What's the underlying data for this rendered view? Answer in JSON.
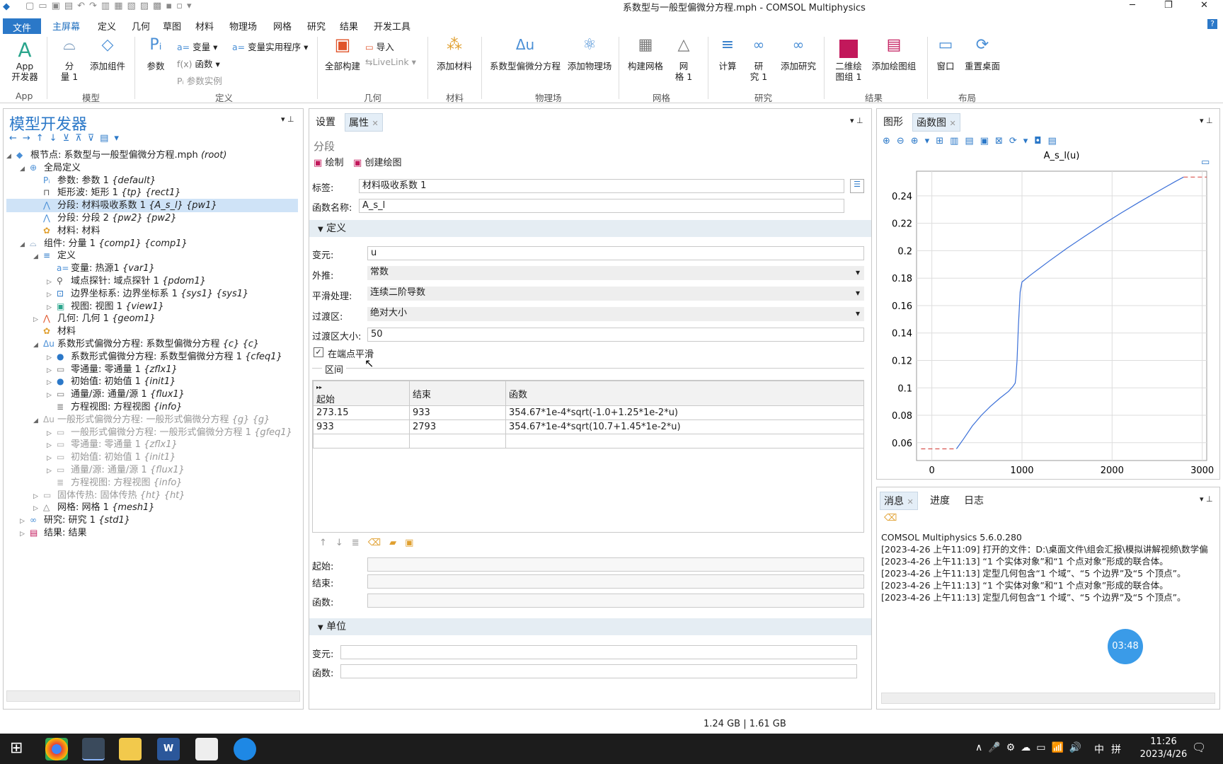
{
  "window": {
    "title": "系数型与一般型偏微分方程.mph - COMSOL Multiphysics"
  },
  "menu": {
    "file": "文件",
    "items": [
      "主屏幕",
      "定义",
      "几何",
      "草图",
      "材料",
      "物理场",
      "网格",
      "研究",
      "结果",
      "开发工具"
    ]
  },
  "ribbon": {
    "app_label1": "App",
    "app_label2": "开发器",
    "app_group": "App",
    "component_label1": "分",
    "component_label2": "量 1",
    "add_component": "添加组件",
    "model_group": "模型",
    "params": "参数",
    "variables": "变量",
    "functions": "函数",
    "param_case": "参数实例",
    "var_utility": "变量实用程序",
    "def_group": "定义",
    "build_all": "全部构建",
    "import": "导入",
    "livelink": "LiveLink",
    "geom_group": "几何",
    "add_material": "添加材料",
    "mat_group": "材料",
    "coef_pde": "系数型偏微分方程",
    "add_physics": "添加物理场",
    "phys_group": "物理场",
    "build_mesh": "构建网格",
    "mesh1_a": "网",
    "mesh1_b": "格 1",
    "mesh_group": "网格",
    "compute": "计算",
    "study1_a": "研",
    "study1_b": "究 1",
    "add_study": "添加研究",
    "study_group": "研究",
    "plot2d_a": "二维绘",
    "plot2d_b": "图组 1",
    "add_plot": "添加绘图组",
    "results_group": "结果",
    "windows": "窗口",
    "reset_desktop": "重置桌面",
    "layout_group": "布局"
  },
  "model_builder": {
    "title": "模型开发器",
    "tree": [
      {
        "label": "根节点: 系数型与一般型偏微分方程.mph ",
        "tag": "(root)"
      },
      {
        "label": "全局定义",
        "tag": ""
      },
      {
        "label": "参数: 参数 1 ",
        "tag": "{default}"
      },
      {
        "label": "矩形波: 矩形 1 ",
        "tag": "{tp} {rect1}"
      },
      {
        "label": "分段: 材料吸收系数 1 ",
        "tag": "{A_s_l} {pw1}"
      },
      {
        "label": "分段: 分段 2 ",
        "tag": "{pw2} {pw2}"
      },
      {
        "label": "材料: 材料",
        "tag": ""
      },
      {
        "label": "组件: 分量 1 ",
        "tag": "{comp1} {comp1}"
      },
      {
        "label": "定义",
        "tag": ""
      },
      {
        "label": "变量: 热源1 ",
        "tag": "{var1}"
      },
      {
        "label": "域点探针: 域点探针 1 ",
        "tag": "{pdom1}"
      },
      {
        "label": "边界坐标系: 边界坐标系 1 ",
        "tag": "{sys1} {sys1}"
      },
      {
        "label": "视图: 视图 1 ",
        "tag": "{view1}"
      },
      {
        "label": "几何: 几何 1 ",
        "tag": "{geom1}"
      },
      {
        "label": "材料",
        "tag": ""
      },
      {
        "label": "系数形式偏微分方程: 系数型偏微分方程 ",
        "tag": "{c} {c}"
      },
      {
        "label": "系数形式偏微分方程: 系数型偏微分方程 1 ",
        "tag": "{cfeq1}"
      },
      {
        "label": "零通量: 零通量 1 ",
        "tag": "{zflx1}"
      },
      {
        "label": "初始值: 初始值 1 ",
        "tag": "{init1}"
      },
      {
        "label": "通量/源: 通量/源 1 ",
        "tag": "{flux1}"
      },
      {
        "label": "方程视图: 方程视图 ",
        "tag": "{info}"
      },
      {
        "label": "一般形式偏微分方程: 一般形式偏微分方程 ",
        "tag": "{g} {g}"
      },
      {
        "label": "一般形式偏微分方程: 一般形式偏微分方程 1 ",
        "tag": "{gfeq1}"
      },
      {
        "label": "零通量: 零通量 1 ",
        "tag": "{zflx1}"
      },
      {
        "label": "初始值: 初始值 1 ",
        "tag": "{init1}"
      },
      {
        "label": "通量/源: 通量/源 1 ",
        "tag": "{flux1}"
      },
      {
        "label": "方程视图: 方程视图 ",
        "tag": "{info}"
      },
      {
        "label": "固体传热: 固体传热 ",
        "tag": "{ht} {ht}"
      },
      {
        "label": "网格: 网格 1 ",
        "tag": "{mesh1}"
      },
      {
        "label": "研究: 研究 1 ",
        "tag": "{std1}"
      },
      {
        "label": "结果: 结果",
        "tag": ""
      }
    ]
  },
  "settings": {
    "tab_settings": "设置",
    "tab_properties": "属性",
    "node_type": "分段",
    "plot": "绘制",
    "create_plot": "创建绘图",
    "label_lbl": "标签:",
    "label_val": "材料吸收系数 1",
    "funcname_lbl": "函数名称:",
    "funcname_val": "A_s_l",
    "def_section": "定义",
    "argument_lbl": "变元:",
    "argument_val": "u",
    "extrap_lbl": "外推:",
    "extrap_val": "常数",
    "smooth_lbl": "平滑处理:",
    "smooth_val": "连续二阶导数",
    "trans_lbl": "过渡区:",
    "trans_val": "绝对大小",
    "transsize_lbl": "过渡区大小:",
    "transsize_val": "50",
    "smooth_ends": "在端点平滑",
    "intervals": "区间",
    "table_headers": [
      "起始",
      "结束",
      "函数"
    ],
    "table_rows": [
      [
        "273.15",
        "933",
        "354.67*1e-4*sqrt(-1.0+1.25*1e-2*u)"
      ],
      [
        "933",
        "2793",
        "354.67*1e-4*sqrt(10.7+1.45*1e-2*u)"
      ]
    ],
    "start_lbl": "起始:",
    "end_lbl": "结束:",
    "func_lbl": "函数:",
    "units_section": "单位",
    "unit_arg_lbl": "变元:",
    "unit_func_lbl": "函数:"
  },
  "graphics": {
    "tab_graphics": "图形",
    "tab_funcplot": "函数图"
  },
  "chart_data": {
    "type": "line",
    "title": "A_s_l(u)",
    "xlabel": "",
    "ylabel": "",
    "xlim": [
      -170,
      3050
    ],
    "ylim": [
      0.047,
      0.258
    ],
    "xticks": [
      0,
      1000,
      2000,
      3000
    ],
    "yticks": [
      0.06,
      0.08,
      0.1,
      0.12,
      0.14,
      0.16,
      0.18,
      0.2,
      0.22,
      0.24
    ],
    "grid": true,
    "series": [
      {
        "color": "#3a6fd8",
        "style": "solid",
        "x": [
          273.15,
          350,
          450,
          550,
          650,
          750,
          850,
          900,
          925,
          933,
          945,
          960,
          980,
          1000,
          1100,
          1300,
          1500,
          1700,
          1900,
          2100,
          2300,
          2500,
          2700,
          2793
        ],
        "y": [
          0.0555,
          0.0626,
          0.0723,
          0.08,
          0.0865,
          0.0922,
          0.0974,
          0.101,
          0.1035,
          0.108,
          0.12,
          0.145,
          0.17,
          0.1772,
          0.1825,
          0.1924,
          0.2018,
          0.2107,
          0.2193,
          0.2275,
          0.2354,
          0.243,
          0.2504,
          0.2537
        ]
      },
      {
        "color": "#d9534f",
        "style": "dashed",
        "x": [
          -120,
          273.15
        ],
        "y": [
          0.0555,
          0.0555
        ]
      },
      {
        "color": "#d9534f",
        "style": "dashed",
        "x": [
          2793,
          3050
        ],
        "y": [
          0.2537,
          0.2537
        ]
      }
    ]
  },
  "messages": {
    "tab_messages": "消息",
    "tab_progress": "进度",
    "tab_log": "日志",
    "lines": [
      "COMSOL Multiphysics 5.6.0.280",
      "[2023-4-26 上午11:09] 打开的文件：D:\\桌面文件\\组会汇报\\模拟讲解视频\\数学偏",
      "[2023-4-26 上午11:13] “1 个实体对象”和“1 个点对象”形成的联合体。",
      "[2023-4-26 上午11:13] 定型几何包含“1 个域”、“5 个边界”及“5 个顶点”。",
      "[2023-4-26 上午11:13] “1 个实体对象”和“1 个点对象”形成的联合体。",
      "[2023-4-26 上午11:13] 定型几何包含“1 个域”、“5 个边界”及“5 个顶点”。"
    ],
    "timer": "03:48"
  },
  "status": {
    "memory": "1.24 GB | 1.61 GB"
  },
  "taskbar": {
    "time": "11:26",
    "date": "2023/4/26",
    "ime": "中"
  }
}
